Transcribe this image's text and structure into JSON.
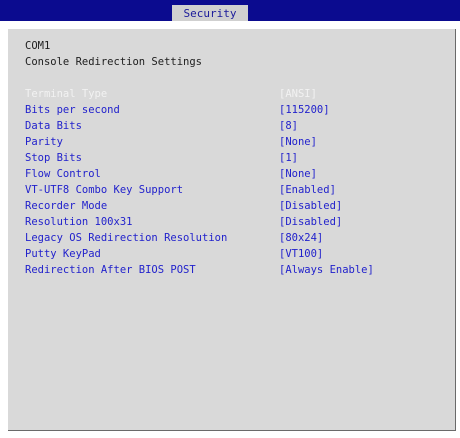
{
  "header": {
    "active_tab": "Security"
  },
  "section": {
    "line1": "COM1",
    "line2": "Console Redirection Settings"
  },
  "settings": [
    {
      "label": "Terminal Type",
      "value": "[ANSI]"
    },
    {
      "label": "Bits per second",
      "value": "[115200]"
    },
    {
      "label": "Data Bits",
      "value": "[8]"
    },
    {
      "label": "Parity",
      "value": "[None]"
    },
    {
      "label": "Stop Bits",
      "value": "[1]"
    },
    {
      "label": "Flow Control",
      "value": "[None]"
    },
    {
      "label": "VT-UTF8 Combo Key Support",
      "value": "[Enabled]"
    },
    {
      "label": "Recorder Mode",
      "value": "[Disabled]"
    },
    {
      "label": "Resolution 100x31",
      "value": "[Disabled]"
    },
    {
      "label": "Legacy OS Redirection Resolution",
      "value": "[80x24]"
    },
    {
      "label": "Putty KeyPad",
      "value": "[VT100]"
    },
    {
      "label": "Redirection After BIOS POST",
      "value": "[Always Enable]"
    }
  ],
  "selected_index": 0,
  "colors": {
    "top_bar": "#0b0b8f",
    "panel": "#d9d9d9",
    "label": "#2222cc",
    "selected_text": "#f2f2f2"
  }
}
